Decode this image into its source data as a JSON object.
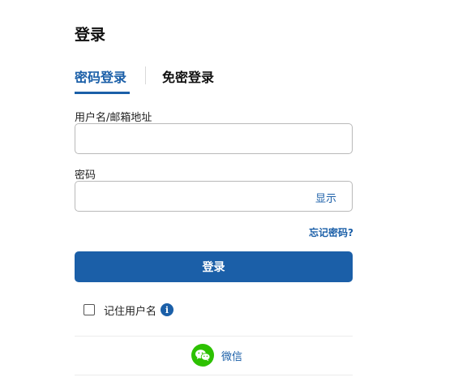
{
  "page": {
    "title": "登录"
  },
  "tabs": [
    {
      "label": "密码登录",
      "active": true
    },
    {
      "label": "免密登录",
      "active": false
    }
  ],
  "form": {
    "username_label": "用户名/邮箱地址",
    "username_value": "",
    "password_label": "密码",
    "password_value": "",
    "show_password_label": "显示",
    "forgot_password_label": "忘记密码?",
    "submit_label": "登录",
    "remember_label": "记住用户名",
    "remember_checked": false
  },
  "social": {
    "wechat_label": "微信"
  },
  "colors": {
    "accent": "#1b5fa8",
    "wechat": "#2dc100",
    "border": "#b9b9b9"
  },
  "icons": {
    "info": "info-icon",
    "wechat": "wechat-icon"
  }
}
